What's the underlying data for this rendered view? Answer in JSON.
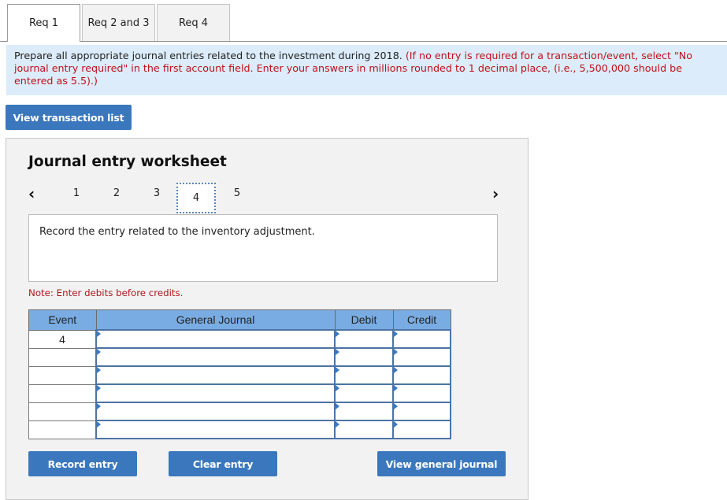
{
  "tabs": [
    {
      "label": "Req 1",
      "active": true
    },
    {
      "label": "Req 2 and 3",
      "active": false
    },
    {
      "label": "Req 4",
      "active": false
    }
  ],
  "instructions": {
    "main": "Prepare all appropriate journal entries related to the investment during 2018. ",
    "note": "(If no entry is required for a transaction/event, select \"No journal entry required\" in the first account field. Enter your answers in millions rounded to 1 decimal place, (i.e., 5,500,000 should be entered as 5.5).)"
  },
  "buttons": {
    "view_transaction_list": "View transaction list",
    "record_entry": "Record entry",
    "clear_entry": "Clear entry",
    "view_general_journal": "View general journal"
  },
  "worksheet": {
    "title": "Journal entry worksheet",
    "prev_icon": "‹",
    "next_icon": "›",
    "pages": [
      "1",
      "2",
      "3",
      "4",
      "5"
    ],
    "active_page": "4",
    "description": "Record the entry related to the inventory adjustment.",
    "note": "Note: Enter debits before credits.",
    "table": {
      "headers": {
        "event": "Event",
        "general_journal": "General Journal",
        "debit": "Debit",
        "credit": "Credit"
      },
      "rows": [
        {
          "event": "4",
          "account": "",
          "debit": "",
          "credit": ""
        },
        {
          "event": "",
          "account": "",
          "debit": "",
          "credit": ""
        },
        {
          "event": "",
          "account": "",
          "debit": "",
          "credit": ""
        },
        {
          "event": "",
          "account": "",
          "debit": "",
          "credit": ""
        },
        {
          "event": "",
          "account": "",
          "debit": "",
          "credit": ""
        },
        {
          "event": "",
          "account": "",
          "debit": "",
          "credit": ""
        }
      ]
    }
  },
  "colors": {
    "button_blue": "#3a77bd",
    "header_blue": "#79ace2",
    "instruction_bg": "#dcecfa",
    "note_red": "#c0101a"
  }
}
